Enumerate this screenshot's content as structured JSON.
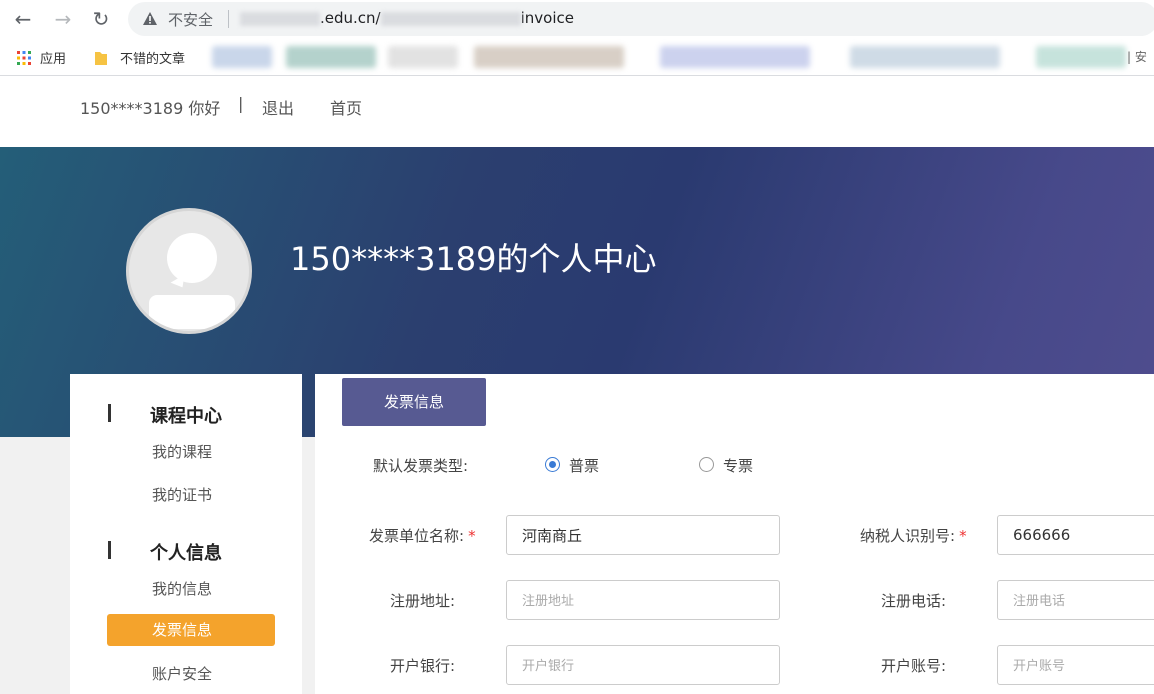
{
  "browser": {
    "security_label": "不安全",
    "url_domain": ".edu.cn/",
    "url_path": "invoice",
    "bookmarks": {
      "apps_label": "应用",
      "folder_label": "不错的文章",
      "trailing_label": "| 安"
    }
  },
  "header": {
    "greeting": "150****3189 你好",
    "separator": "|",
    "logout": "退出",
    "home": "首页"
  },
  "banner": {
    "title": "150****3189的个人中心"
  },
  "sidebar": {
    "sections": [
      {
        "title": "课程中心",
        "items": [
          "我的课程",
          "我的证书"
        ]
      },
      {
        "title": "个人信息",
        "items": [
          "我的信息",
          "发票信息",
          "账户安全"
        ]
      }
    ],
    "active_item": "发票信息"
  },
  "main": {
    "tab_label": "发票信息",
    "invoice_type_label": "默认发票类型:",
    "invoice_type_options": [
      "普票",
      "专票"
    ],
    "invoice_type_selected": "普票",
    "company_name_label": "发票单位名称:",
    "company_name_value": "河南商丘",
    "taxpayer_id_label": "纳税人识别号:",
    "taxpayer_id_value": "666666",
    "reg_address_label": "注册地址:",
    "reg_address_placeholder": "注册地址",
    "reg_phone_label": "注册电话:",
    "reg_phone_placeholder": "注册电话",
    "bank_label": "开户银行:",
    "bank_placeholder": "开户银行",
    "account_label": "开户账号:",
    "account_placeholder": "开户账号"
  },
  "colors": {
    "accent_purple": "#575a92",
    "active_orange": "#f4a32c",
    "required_red": "#e33",
    "radio_blue": "#3a7bd5"
  }
}
